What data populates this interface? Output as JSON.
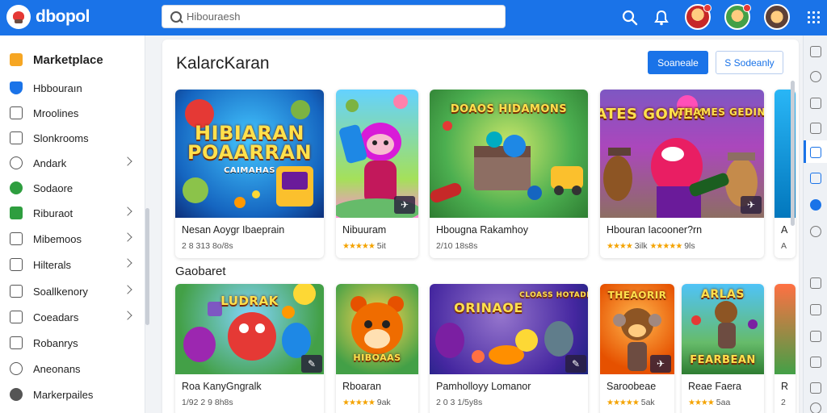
{
  "app": {
    "name": "dbopol"
  },
  "search": {
    "placeholder": "Hibouraesh"
  },
  "header": {
    "icons": [
      "search-icon",
      "bell-icon"
    ],
    "colors": {
      "bar": "#1a73e8"
    }
  },
  "sidebar": {
    "title": "Marketplace",
    "items": [
      {
        "label": "Hbbouraın",
        "icon": "shield-icon",
        "color": "#1a73e8"
      },
      {
        "label": "Mroolines",
        "icon": "store-icon"
      },
      {
        "label": "Slonkrooms",
        "icon": "rooms-icon"
      },
      {
        "label": "Andark",
        "icon": "link-icon"
      },
      {
        "label": "Sodaore",
        "icon": "circle-icon",
        "color": "#2e9e3f"
      },
      {
        "label": "Riburaot",
        "icon": "book-icon",
        "color": "#2e9e3f"
      },
      {
        "label": "Mibemoos",
        "icon": "grid-icon"
      },
      {
        "label": "Hilterals",
        "icon": "chart-icon"
      },
      {
        "label": "Soallkenory",
        "icon": "window-icon"
      },
      {
        "label": "Coeadars",
        "icon": "calendar-icon"
      },
      {
        "label": "Robanrys",
        "icon": "list-icon"
      },
      {
        "label": "Aneonans",
        "icon": "heart-icon"
      },
      {
        "label": "Markerpailes",
        "icon": "settings-icon"
      }
    ]
  },
  "main": {
    "title": "KalarcKaran",
    "primary_button": "Soaneale",
    "secondary_button": "S Sodeanly",
    "section2_title": "Gaobaret"
  },
  "row1": [
    {
      "title": "Nesan Aoygr Ibaeprain",
      "meta": "2 8 313 8o/8s",
      "art_text": "HIBIARAN POAARRAN",
      "art_sub": "CAIMAHAS"
    },
    {
      "title": "Nibuuram",
      "meta": "★★★★★ 5it"
    },
    {
      "title": "Hbougna Rakamhoy",
      "meta": "2/10 18s8s",
      "art_text": "DOAOS HIDAMONS"
    },
    {
      "title": "Hbouran Iacooner?rn",
      "meta": "★★★★ 3ilk  ★★★★★ 9ls",
      "art_text": "TATES GOMEK",
      "art_text2": "THAMES GEDINES"
    },
    {
      "title": "A",
      "meta": "A"
    }
  ],
  "row2": [
    {
      "title": "Roa KanyGngralk",
      "meta": "1/92 2 9 8h8s",
      "art_text": "LUDRAK"
    },
    {
      "title": "Rboaran",
      "meta": "★★★★★ 9ak",
      "art_text": "HIBOAAS"
    },
    {
      "title": "Pamholloyy Lomanor",
      "meta": "2 0 3 1/5y8s",
      "art_text": "ORINAOE",
      "art_text2": "CLOASS HOTADE"
    },
    {
      "title": "Saroobeae",
      "meta": "★★★★★ 5ak",
      "art_text": "THEAORIR"
    },
    {
      "title": "Reae Faera",
      "meta": "★★★★ 5aa",
      "art_text": "ARLAS",
      "art_text2": "FEARBEAN"
    },
    {
      "title": "R",
      "meta": "2"
    }
  ]
}
